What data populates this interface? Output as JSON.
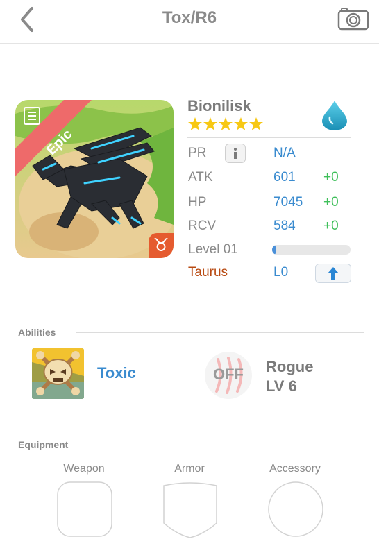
{
  "header": {
    "title": "Tox/R6"
  },
  "monster": {
    "name": "Bionilisk",
    "stars": 5,
    "rarity": "Epic",
    "element": "water-drop-icon",
    "zodiac_symbol": "♉"
  },
  "stats": {
    "pr_label": "PR",
    "pr_value": "N/A",
    "atk_label": "ATK",
    "atk_value": "601",
    "atk_bonus": "+0",
    "hp_label": "HP",
    "hp_value": "7045",
    "hp_bonus": "+0",
    "rcv_label": "RCV",
    "rcv_value": "584",
    "rcv_bonus": "+0",
    "level_label": "Level 01",
    "level_progress": 0.04,
    "zodiac_label": "Taurus",
    "zodiac_level": "L0"
  },
  "abilities": {
    "section_title": "Abilities",
    "primary": {
      "name": "Toxic"
    },
    "secondary": {
      "status": "OFF",
      "name": "Rogue",
      "level": "LV 6"
    }
  },
  "equipment": {
    "section_title": "Equipment",
    "slots": [
      "Weapon",
      "Armor",
      "Accessory"
    ]
  },
  "colors": {
    "accent_blue": "#3a8bcf",
    "bonus_green": "#3fbf5a",
    "zodiac_brown": "#b84a12",
    "epic_red": "#ee6a6a"
  }
}
